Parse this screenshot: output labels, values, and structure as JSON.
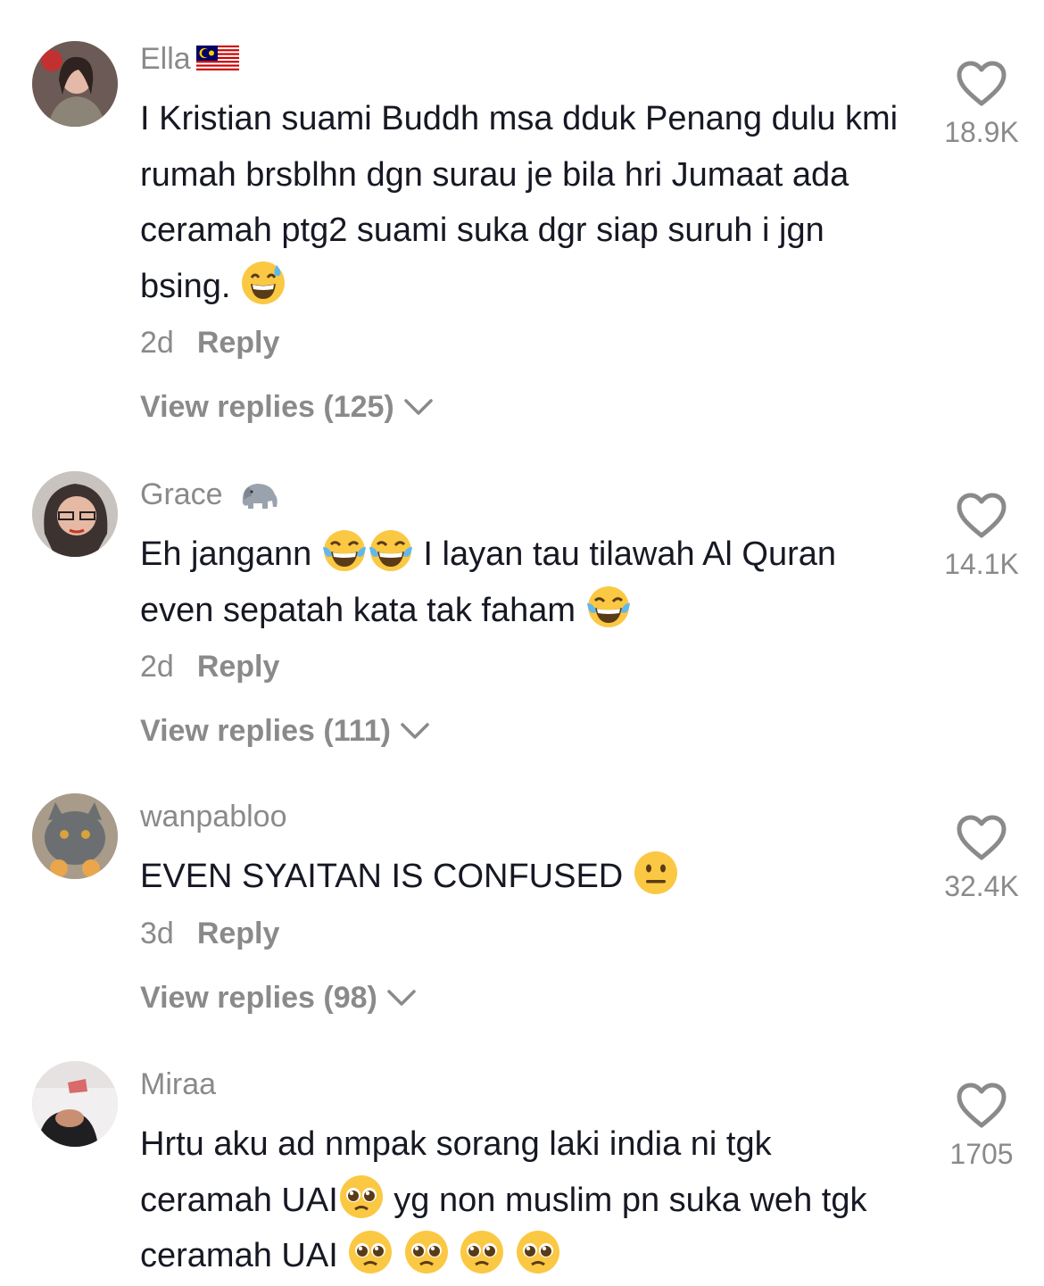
{
  "comments": [
    {
      "username": "Ella",
      "username_badge": "malaysia-flag",
      "text": "I Kristian suami Buddh msa dduk Penang dulu kmi rumah brsblhn dgn surau je bila hri Jumaat ada ceramah ptg2 suami suka dgr siap suruh i jgn bsing.",
      "emojis": [
        "grinning-sweat-emoji"
      ],
      "age": "2d",
      "reply_label": "Reply",
      "view_replies": "View replies (125)",
      "likes": "18.9K"
    },
    {
      "username": "Grace",
      "username_badge": "elephant-emoji",
      "text_a": "Eh jangann",
      "text_b": "I layan tau tilawah Al Quran even sepatah kata tak faham",
      "emojis": [
        "tears-of-joy-emoji"
      ],
      "age": "2d",
      "reply_label": "Reply",
      "view_replies": "View replies (111)",
      "likes": "14.1K"
    },
    {
      "username": "wanpabloo",
      "text": "EVEN SYAITAN IS CONFUSED",
      "emojis": [
        "neutral-face-emoji"
      ],
      "age": "3d",
      "reply_label": "Reply",
      "view_replies": "View replies (98)",
      "likes": "32.4K"
    },
    {
      "username": "Miraa",
      "text_a": "Hrtu aku ad nmpak sorang laki india ni tgk ceramah UAI",
      "text_b": " yg non muslim pn suka weh tgk ceramah UAI",
      "emojis": [
        "pleading-face-emoji"
      ],
      "likes": "1705"
    }
  ],
  "colors": {
    "text": "#161823",
    "muted": "#8a8a8a",
    "background": "#ffffff"
  }
}
